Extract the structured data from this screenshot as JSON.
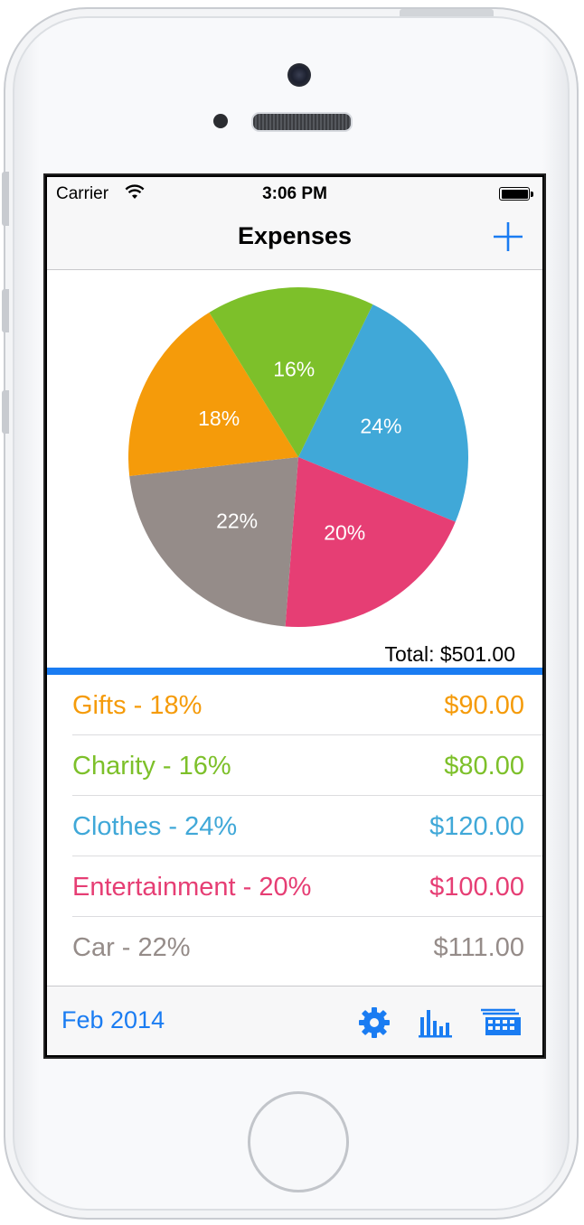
{
  "status": {
    "carrier": "Carrier",
    "time": "3:06 PM"
  },
  "nav": {
    "title": "Expenses",
    "add_icon": "plus-icon"
  },
  "colors": {
    "accent": "#1a7cf2",
    "gifts": "#f59b0a",
    "charity": "#7dc02a",
    "clothes": "#40a8d8",
    "entertainment": "#e63e74",
    "car": "#958c89"
  },
  "chart_data": {
    "type": "pie",
    "slices": [
      {
        "label": "24%",
        "category": "Clothes",
        "value": 24,
        "color": "#40a8d8"
      },
      {
        "label": "20%",
        "category": "Entertainment",
        "value": 20,
        "color": "#e63e74"
      },
      {
        "label": "22%",
        "category": "Car",
        "value": 22,
        "color": "#958c89"
      },
      {
        "label": "18%",
        "category": "Gifts",
        "value": 18,
        "color": "#f59b0a"
      },
      {
        "label": "16%",
        "category": "Charity",
        "value": 16,
        "color": "#7dc02a"
      }
    ]
  },
  "total_text": "Total: $501.00",
  "expenses": [
    {
      "label": "Gifts - 18%",
      "amount": "$90.00",
      "color": "#f59b0a"
    },
    {
      "label": "Charity - 16%",
      "amount": "$80.00",
      "color": "#7dc02a"
    },
    {
      "label": "Clothes - 24%",
      "amount": "$120.00",
      "color": "#40a8d8"
    },
    {
      "label": "Entertainment - 20%",
      "amount": "$100.00",
      "color": "#e63e74"
    },
    {
      "label": "Car - 22%",
      "amount": "$111.00",
      "color": "#958c89"
    }
  ],
  "toolbar": {
    "month": "Feb 2014",
    "icons": [
      "gear-icon",
      "bar-chart-icon",
      "calendar-grid-icon"
    ]
  }
}
